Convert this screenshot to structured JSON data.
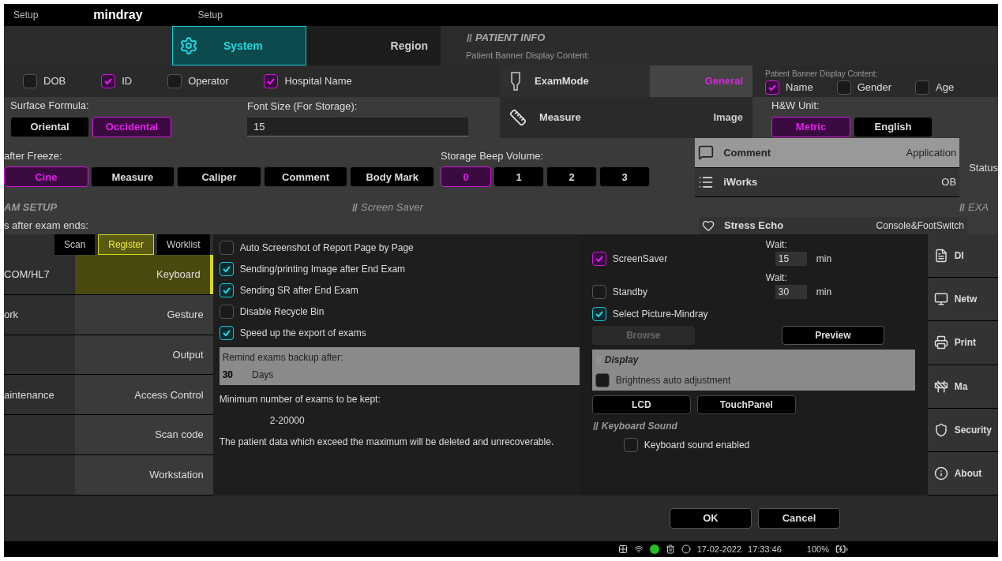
{
  "title_bar": {
    "title": "Setup",
    "logo": "mindray",
    "page": "Setup"
  },
  "top_tabs": [
    {
      "label": "System",
      "selected": true
    },
    {
      "label": "Region",
      "selected": false
    }
  ],
  "patient_info": {
    "heading": "PATIENT INFO",
    "banner_label": "Patient Banner Display Content:",
    "fields": [
      {
        "label": "DOB",
        "checked": false
      },
      {
        "label": "ID",
        "checked": true
      },
      {
        "label": "Operator",
        "checked": false
      },
      {
        "label": "Hospital Name",
        "checked": true
      }
    ]
  },
  "preset_nav": [
    {
      "label": "ExamMode",
      "selected": false
    },
    {
      "label": "Measure",
      "selected": false
    }
  ],
  "preset_tabs": [
    {
      "label": "General",
      "selected": true
    },
    {
      "label": "Image",
      "selected": false
    }
  ],
  "patient_fields_right": {
    "label": "Patient Banner Display Content:",
    "fields": [
      {
        "label": "Name",
        "checked": true
      },
      {
        "label": "Gender",
        "checked": false
      },
      {
        "label": "Age",
        "checked": false
      }
    ]
  },
  "surface_formula": {
    "label": "Surface Formula:",
    "options": [
      {
        "label": "Oriental",
        "selected": false
      },
      {
        "label": "Occidental",
        "selected": true
      }
    ]
  },
  "font_size": {
    "label": "Font Size (For Storage):",
    "value": "15"
  },
  "hw_unit": {
    "label": "H&W Unit:",
    "options": [
      {
        "label": "Metric",
        "selected": true
      },
      {
        "label": "English",
        "selected": false
      }
    ]
  },
  "after_freeze": {
    "label": "after Freeze:",
    "options": [
      {
        "label": "Cine",
        "selected": true
      },
      {
        "label": "Measure",
        "selected": false
      },
      {
        "label": "Caliper",
        "selected": false
      },
      {
        "label": "Comment",
        "selected": false
      },
      {
        "label": "Body Mark",
        "selected": false
      }
    ]
  },
  "beep_volume": {
    "label": "Storage Beep Volume:",
    "options": [
      {
        "label": "0",
        "selected": true
      },
      {
        "label": "1",
        "selected": false
      },
      {
        "label": "2",
        "selected": false
      },
      {
        "label": "3",
        "selected": false
      }
    ]
  },
  "menu_list": [
    {
      "label": "Comment",
      "value": "Application"
    },
    {
      "label": "iWorks",
      "value": "OB"
    },
    {
      "label": "Stress Echo",
      "value": "Console&FootSwitch"
    }
  ],
  "status_label": "Status",
  "section_headers": {
    "exam_setup": "AM SETUP",
    "screen_saver": "Screen Saver",
    "exam_right": "EXA",
    "after_exam": "s after exam ends:"
  },
  "left_tabs": [
    {
      "label": "Scan",
      "selected": false
    },
    {
      "label": "Register",
      "selected": true
    },
    {
      "label": "Worklist",
      "selected": false
    }
  ],
  "left_nav": [
    {
      "left": "COM/HL7",
      "right": "Keyboard",
      "selected": true
    },
    {
      "left": "ork",
      "right": "Gesture",
      "selected": false
    },
    {
      "right": "Output",
      "selected": false
    },
    {
      "left": "aintenance",
      "right": "Access Control",
      "selected": false
    },
    {
      "right": "Scan code",
      "selected": false
    },
    {
      "right": "Workstation",
      "selected": false
    }
  ],
  "options": [
    {
      "label": "Auto Screenshot of Report Page by Page",
      "checked": false
    },
    {
      "label": "Sending/printing Image after End Exam",
      "checked": true
    },
    {
      "label": "Sending SR after End Exam",
      "checked": true
    },
    {
      "label": "Disable Recycle Bin",
      "checked": false
    },
    {
      "label": "Speed up the export of exams",
      "checked": true
    }
  ],
  "remind": {
    "label": "Remind exams backup after:",
    "value": "30",
    "unit": "Days"
  },
  "minimum": {
    "label": "Minimum number of exams to be kept:",
    "range": "2-20000",
    "note": "The patient data which exceed the maximum will be deleted and unrecoverable."
  },
  "screen_saver": [
    {
      "wait": "Wait:",
      "label": "ScreenSaver",
      "checked": true,
      "value": "15",
      "unit": "min"
    },
    {
      "wait": "Wait:",
      "label": "Standby",
      "checked": false,
      "value": "30",
      "unit": "min"
    }
  ],
  "select_picture": {
    "label": "Select Picture-Mindray",
    "checked": true
  },
  "browse": {
    "label": "Browse",
    "disabled": true
  },
  "preview": {
    "label": "Preview",
    "disabled": false
  },
  "display": {
    "heading": "Display",
    "brightness": {
      "label": "Brightness auto adjustment",
      "checked": false
    },
    "targets": [
      {
        "label": "LCD",
        "selected": false
      },
      {
        "label": "TouchPanel",
        "selected": false
      }
    ]
  },
  "keyboard_sound": {
    "heading": "Keyboard Sound",
    "option": {
      "label": "Keyboard sound enabled",
      "checked": false
    }
  },
  "right_nav": [
    {
      "label": "DI"
    },
    {
      "label": "Netw"
    },
    {
      "label": "Print"
    },
    {
      "label": "Ma"
    },
    {
      "label": "Security"
    },
    {
      "label": "About"
    }
  ],
  "footer_buttons": [
    "OK",
    "Cancel"
  ],
  "status_bar": {
    "date": "17-02-2022",
    "time": "17:33:46",
    "battery": "100%"
  }
}
